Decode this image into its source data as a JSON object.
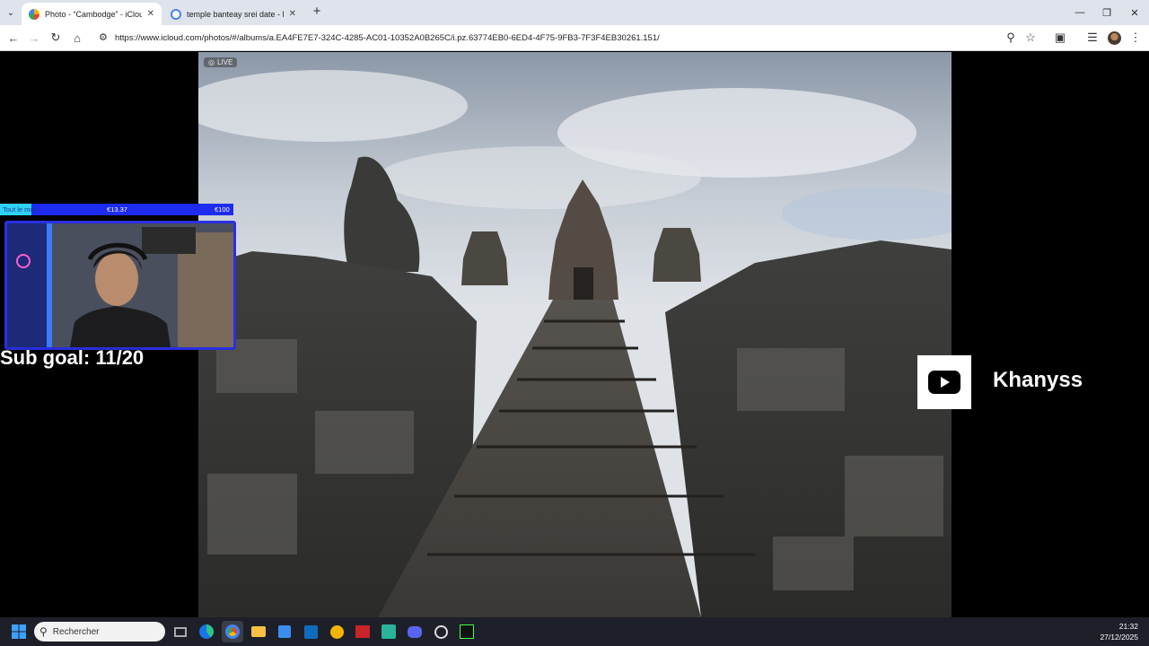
{
  "browser": {
    "tabs": [
      {
        "title": "Photo - “Cambodge” - iCloud P",
        "active": true
      },
      {
        "title": "temple banteay srei date - Rech",
        "active": false
      }
    ],
    "new_tab": "+",
    "url": "https://www.icloud.com/photos/#/albums/a.EA4FE7E7-324C-4285-AC01-10352A0B265C/i.pz.63774EB0-6ED4-4F75-9FB3-7F3F4EB30261.151/"
  },
  "photo": {
    "live_label": "LIVE"
  },
  "stream": {
    "goal": {
      "label": "Tout le mois:",
      "current": "€13.37",
      "target": "€100",
      "progress": 0.1337
    },
    "sub_goal": "Sub goal: 11/20",
    "channel_name": "Khanyss"
  },
  "taskbar": {
    "search_placeholder": "Rechercher",
    "time": "21:32",
    "date": "27/12/2025"
  },
  "colors": {
    "goal_bar": "#1e2cf0",
    "goal_fill": "#2fd2f5",
    "youtube_red": "#000000"
  }
}
